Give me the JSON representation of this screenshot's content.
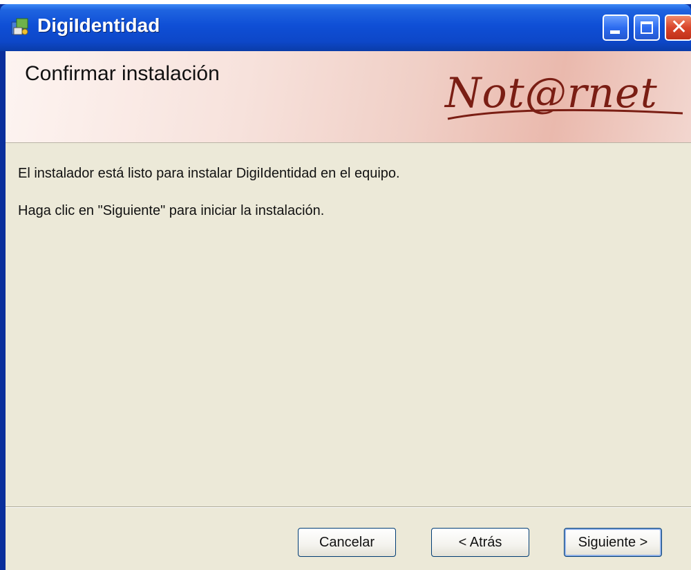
{
  "window": {
    "title": "DigiIdentidad"
  },
  "header": {
    "title": "Confirmar instalación",
    "logo_text": "Not@rnet"
  },
  "content": {
    "line1": "El instalador está listo para instalar DigiIdentidad en el equipo.",
    "line2": "Haga clic en \"Siguiente\" para iniciar la instalación."
  },
  "buttons": {
    "cancel": "Cancelar",
    "back": "< Atrás",
    "next": "Siguiente >"
  },
  "icons": {
    "app": "installer-icon",
    "minimize": "minimize-icon",
    "maximize": "maximize-icon",
    "close": "close-icon"
  },
  "colors": {
    "titlebar": "#0d47c8",
    "client_bg": "#ece9d8",
    "logo": "#7a1e14",
    "close_button": "#d9452a"
  }
}
